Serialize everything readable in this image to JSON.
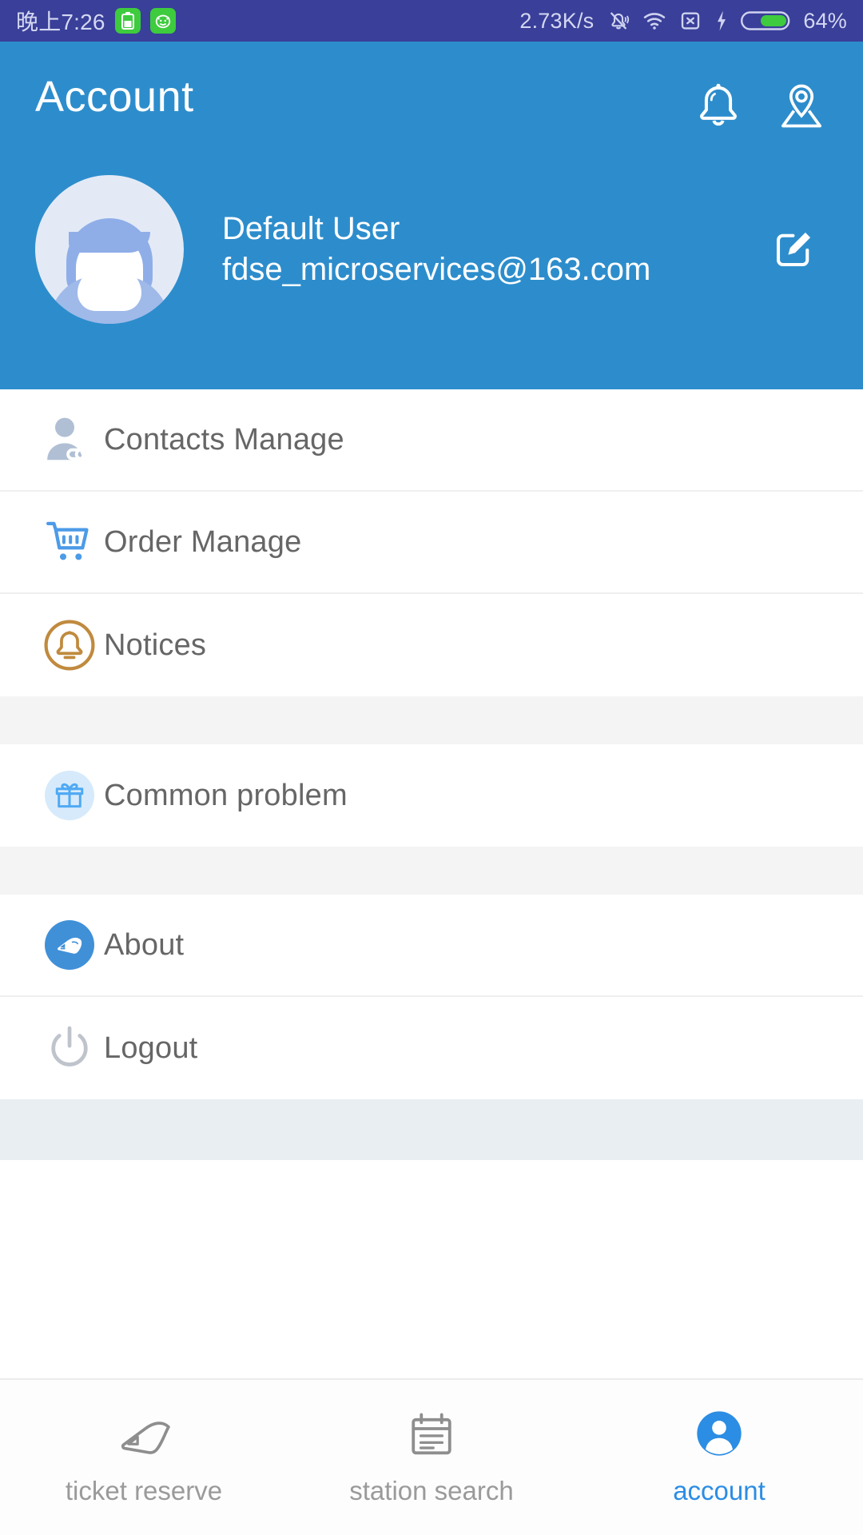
{
  "status_bar": {
    "time": "晚上7:26",
    "network_speed": "2.73K/s",
    "battery_percent": "64%",
    "icons": [
      "battery-saver-icon",
      "monster-toy-icon",
      "bell-muted-icon",
      "wifi-icon",
      "no-sim-icon",
      "charging-bolt-icon",
      "battery-icon"
    ]
  },
  "header": {
    "title": "Account",
    "notification_icon": "bell-icon",
    "location_icon": "map-pin-icon",
    "accent_color": "#2D8DCC"
  },
  "profile": {
    "avatar_icon": "default-avatar-icon",
    "name": "Default User",
    "email": "fdse_microservices@163.com",
    "edit_icon": "edit-pencil-icon"
  },
  "menu": {
    "groups": [
      {
        "items": [
          {
            "label": "Contacts Manage",
            "icon": "contacts-person-link-icon",
            "color": "#B0BFD4"
          },
          {
            "label": "Order Manage",
            "icon": "shopping-cart-icon",
            "color": "#4C9BE8"
          },
          {
            "label": "Notices",
            "icon": "bell-circle-icon",
            "color": "#C08A3E"
          }
        ]
      },
      {
        "items": [
          {
            "label": "Common problem",
            "icon": "gift-box-icon",
            "color": "#4FA9F3"
          }
        ]
      },
      {
        "items": [
          {
            "label": "About",
            "icon": "train-circle-icon",
            "color": "#4090D8"
          },
          {
            "label": "Logout",
            "icon": "power-off-icon",
            "color": "#BFC4CC"
          }
        ]
      }
    ]
  },
  "bottom_nav": {
    "items": [
      {
        "label": "ticket reserve",
        "icon": "train-outline-icon",
        "active": false
      },
      {
        "label": "station search",
        "icon": "clipboard-list-icon",
        "active": false
      },
      {
        "label": "account",
        "icon": "account-circle-icon",
        "active": true
      }
    ],
    "active_color": "#2C8DE4",
    "inactive_color": "#9A9A9A"
  }
}
